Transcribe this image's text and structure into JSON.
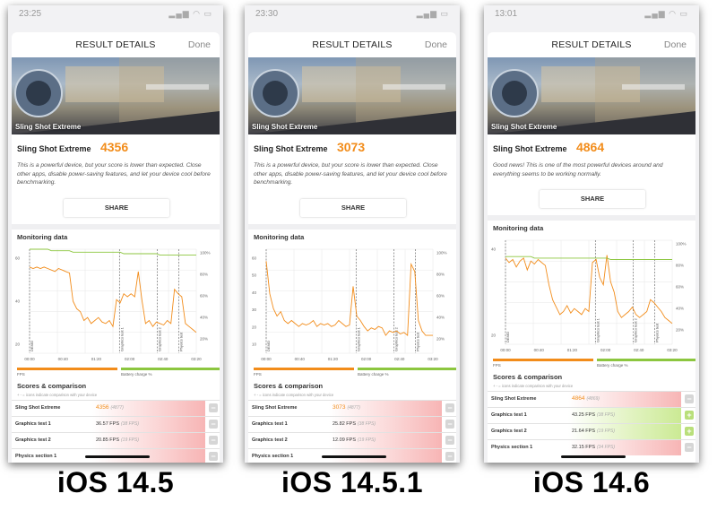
{
  "header": {
    "title": "RESULT DETAILS",
    "done": "Done"
  },
  "share_label": "SHARE",
  "monitoring_title": "Monitoring data",
  "scores_title": "Scores & comparison",
  "scores_note": "+ - = icons indicate comparison with your device",
  "banner_label": "Sling Shot Extreme",
  "legend": {
    "fps": "FPS",
    "battery": "Battery charge %"
  },
  "axis": {
    "phase_labels": [
      "DEMO",
      "Graphics test 1",
      "Graphics test 2",
      "Physics test"
    ],
    "right_ticks": [
      "100%",
      "80%",
      "60%",
      "40%",
      "20%"
    ]
  },
  "colors": {
    "accent": "#f28c1a",
    "fps_line": "#f28c1a",
    "battery_line": "#8cc63f",
    "worse": "#f7b5b5",
    "better": "#cbea94"
  },
  "phones": [
    {
      "time": "23:25",
      "caption": "iOS 14.5",
      "bench": "Sling Shot Extreme",
      "score": "4356",
      "description": "This is a powerful device, but your score is lower than expected. Close other apps, disable power-saving features, and let your device cool before benchmarking.",
      "rows": [
        {
          "name": "Sling Shot Extreme",
          "value": "4356",
          "ref": "(4877)",
          "state": "minus"
        },
        {
          "name": "Graphics test 1",
          "value": "36.57 FPS",
          "ref": "(38 FPS)",
          "state": "minus"
        },
        {
          "name": "Graphics test 2",
          "value": "20.85 FPS",
          "ref": "(19 FPS)",
          "state": "minus"
        },
        {
          "name": "Physics section 1",
          "value": "",
          "ref": "",
          "state": "minus"
        }
      ],
      "chart": {
        "y_left_ticks": [
          "60",
          "40",
          "20"
        ],
        "x_ticks": [
          "00:00",
          "00:40",
          "01:20",
          "02:00",
          "02:40",
          "03:20"
        ]
      }
    },
    {
      "time": "23:30",
      "caption": "iOS 14.5.1",
      "bench": "Sling Shot Extreme",
      "score": "3073",
      "description": "This is a powerful device, but your score is lower than expected. Close other apps, disable power-saving features, and let your device cool before benchmarking.",
      "rows": [
        {
          "name": "Sling Shot Extreme",
          "value": "3073",
          "ref": "(4877)",
          "state": "minus"
        },
        {
          "name": "Graphics test 1",
          "value": "25.82 FPS",
          "ref": "(38 FPS)",
          "state": "minus"
        },
        {
          "name": "Graphics test 2",
          "value": "12.09 FPS",
          "ref": "(19 FPS)",
          "state": "minus"
        },
        {
          "name": "Physics section 1",
          "value": "",
          "ref": "",
          "state": "minus"
        }
      ],
      "chart": {
        "y_left_ticks": [
          "60",
          "50",
          "40",
          "30",
          "20",
          "10"
        ],
        "x_ticks": [
          "00:00",
          "00:40",
          "01:20",
          "02:00",
          "02:40",
          "03:20"
        ]
      }
    },
    {
      "time": "13:01",
      "caption": "iOS 14.6",
      "bench": "Sling Shot Extreme",
      "score": "4864",
      "description": "Good news! This is one of the most powerful devices around and everything seems to be working normally.",
      "rows": [
        {
          "name": "Sling Shot Extreme",
          "value": "4864",
          "ref": "(4869)",
          "state": "minus"
        },
        {
          "name": "Graphics test 1",
          "value": "43.25 FPS",
          "ref": "(38 FPS)",
          "state": "plus"
        },
        {
          "name": "Graphics test 2",
          "value": "21.64 FPS",
          "ref": "(19 FPS)",
          "state": "plus"
        },
        {
          "name": "Physics section 1",
          "value": "32.15 FPS",
          "ref": "(34 FPS)",
          "state": "minus"
        }
      ],
      "chart": {
        "y_left_ticks": [
          "40",
          "20"
        ],
        "x_ticks": [
          "00:00",
          "00:40",
          "01:20",
          "02:00",
          "02:40",
          "03:20"
        ]
      }
    }
  ],
  "chart_data": [
    {
      "type": "line",
      "title": "Monitoring data",
      "x": [
        0,
        5,
        10,
        15,
        20,
        25,
        30,
        35,
        40,
        45,
        50,
        55,
        60,
        65,
        70,
        75,
        80,
        85,
        90,
        95,
        100,
        105,
        110,
        115,
        120,
        125,
        130,
        135,
        140,
        145,
        150,
        155,
        160,
        165,
        170,
        175,
        180,
        185,
        190,
        195,
        200,
        205,
        210,
        215,
        220,
        225,
        230
      ],
      "series": [
        {
          "name": "FPS",
          "values": [
            58,
            57,
            58,
            57,
            58,
            57,
            56,
            55,
            57,
            56,
            55,
            54,
            35,
            30,
            28,
            22,
            24,
            20,
            22,
            24,
            21,
            20,
            22,
            18,
            36,
            34,
            40,
            38,
            40,
            38,
            55,
            36,
            20,
            22,
            18,
            21,
            20,
            19,
            22,
            20,
            43,
            40,
            38,
            20,
            18,
            16,
            14
          ]
        },
        {
          "name": "Battery charge %",
          "values": [
            70,
            70,
            70,
            70,
            70,
            70,
            69,
            69,
            69,
            69,
            69,
            69,
            68,
            68,
            68,
            68,
            68,
            68,
            68,
            68,
            68,
            68,
            68,
            68,
            68,
            68,
            67,
            67,
            67,
            67,
            67,
            67,
            67,
            67,
            67,
            67,
            66,
            66,
            66,
            66,
            66,
            66,
            66,
            66,
            66,
            66,
            66
          ]
        }
      ],
      "ylim": [
        0,
        70
      ]
    },
    {
      "type": "line",
      "title": "Monitoring data",
      "x": [
        0,
        5,
        10,
        15,
        20,
        25,
        30,
        35,
        40,
        45,
        50,
        55,
        60,
        65,
        70,
        75,
        80,
        85,
        90,
        95,
        100,
        105,
        110,
        115,
        120,
        125,
        130,
        135,
        140,
        145,
        150,
        155,
        160,
        165,
        170,
        175,
        180,
        185,
        190,
        195,
        200,
        205,
        210,
        215,
        220,
        225,
        230
      ],
      "series": [
        {
          "name": "FPS",
          "values": [
            62,
            40,
            30,
            25,
            28,
            22,
            20,
            22,
            20,
            18,
            20,
            19,
            20,
            22,
            18,
            20,
            19,
            20,
            18,
            19,
            22,
            20,
            18,
            19,
            45,
            25,
            22,
            18,
            15,
            17,
            16,
            18,
            17,
            12,
            15,
            14,
            15,
            13,
            14,
            12,
            60,
            55,
            22,
            15,
            12,
            12,
            12
          ]
        },
        {
          "name": "Battery charge %",
          "values": [
            78,
            78,
            78,
            78,
            78,
            78,
            78,
            78,
            78,
            78,
            78,
            78,
            78,
            78,
            78,
            78,
            78,
            78,
            78,
            78,
            78,
            78,
            78,
            78,
            78,
            78,
            78,
            78,
            78,
            78,
            78,
            78,
            78,
            78,
            78,
            78,
            78,
            78,
            78,
            78,
            78,
            78,
            78,
            78,
            78,
            78,
            78
          ]
        }
      ],
      "ylim": [
        0,
        70
      ]
    },
    {
      "type": "line",
      "title": "Monitoring data",
      "x": [
        0,
        5,
        10,
        15,
        20,
        25,
        30,
        35,
        40,
        45,
        50,
        55,
        60,
        65,
        70,
        75,
        80,
        85,
        90,
        95,
        100,
        105,
        110,
        115,
        120,
        125,
        130,
        135,
        140,
        145,
        150,
        155,
        160,
        165,
        170,
        175,
        180,
        185,
        190,
        195,
        200,
        205,
        210,
        215,
        220,
        225,
        230
      ],
      "series": [
        {
          "name": "FPS",
          "values": [
            58,
            55,
            57,
            52,
            56,
            58,
            50,
            56,
            54,
            57,
            55,
            53,
            40,
            30,
            25,
            20,
            22,
            26,
            21,
            24,
            22,
            20,
            24,
            22,
            55,
            57,
            45,
            40,
            60,
            42,
            35,
            22,
            18,
            20,
            22,
            25,
            20,
            18,
            20,
            22,
            30,
            28,
            25,
            22,
            18,
            16,
            14
          ]
        },
        {
          "name": "Battery charge %",
          "values": [
            59,
            59,
            59,
            59,
            59,
            59,
            59,
            59,
            58,
            58,
            58,
            58,
            58,
            58,
            58,
            58,
            58,
            58,
            58,
            58,
            58,
            58,
            58,
            58,
            58,
            58,
            58,
            58,
            58,
            57,
            57,
            57,
            57,
            57,
            57,
            57,
            57,
            57,
            57,
            57,
            57,
            57,
            57,
            57,
            57,
            57,
            57
          ]
        }
      ],
      "ylim": [
        0,
        70
      ]
    }
  ]
}
